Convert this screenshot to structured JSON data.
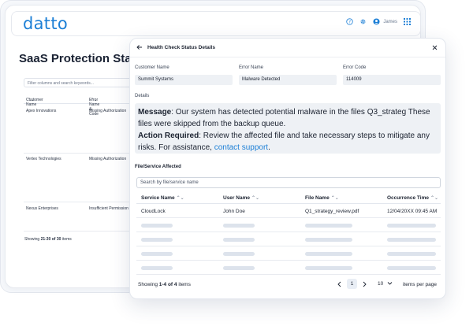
{
  "app": {
    "logo": "datto",
    "user_name": "James",
    "page_title": "SaaS Protection Status"
  },
  "background_table": {
    "filter_placeholder": "Filter columns and search keywords...",
    "col_customer": "Customer Name",
    "col_error": "Error Name & Code",
    "rows": [
      {
        "customer": "Apex Innovations",
        "error": "Missing Authorization"
      },
      {
        "customer": "Vertex Technologies",
        "error": "Missing Authorization"
      },
      {
        "customer": "Nexus Enterprises",
        "error": "Insufficient Permission"
      }
    ],
    "footer_prefix": "Showing ",
    "footer_range": "21-30 of 30",
    "footer_suffix": " items"
  },
  "modal": {
    "title": "Health Check Status Details",
    "fields": {
      "customer_label": "Customer Name",
      "customer_value": "Summit Systems",
      "error_label": "Error Name",
      "error_value": "Malware Detected",
      "code_label": "Error Code",
      "code_value": "114009"
    },
    "details_label": "Details",
    "details": {
      "message_label": "Message",
      "message_text": ": Our system has detected potential malware in the files Q3_strateg These files were skipped from the backup queue.",
      "action_label": "Action Required",
      "action_text": ": Review the affected file and take necessary steps to mitigate any risks. For assistance, ",
      "support_link": "contact support",
      "end_text": "."
    },
    "section_label": "File/Service Affected",
    "search_placeholder": "Search by file/service name",
    "columns": {
      "service": "Service Name",
      "user": "User Name",
      "file": "File Name",
      "time": "Occurrence Time"
    },
    "rows": [
      {
        "service": "CloudLock",
        "user": "John Doe",
        "file": "Q1_strategy_review.pdf",
        "time": "12/04/20XX 09:45 AM"
      }
    ],
    "footer": {
      "prefix": "Showing ",
      "range": "1-4 of 4",
      "suffix": " items",
      "page": "1",
      "per_page": "10",
      "per_page_label": "items per page"
    }
  },
  "colors": {
    "accent": "#1c7fd6",
    "skeleton": "#dde3ec",
    "field_bg": "#eef1f5"
  }
}
